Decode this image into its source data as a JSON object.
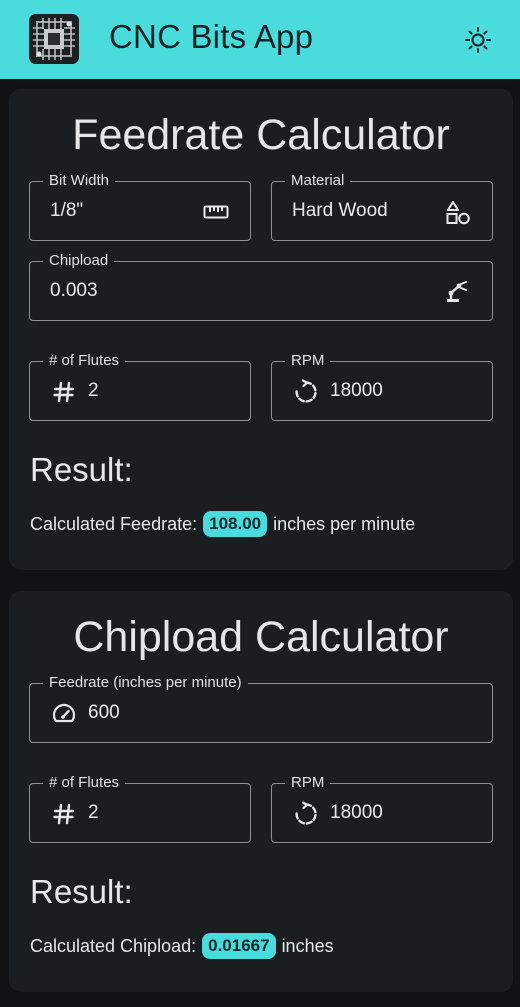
{
  "app": {
    "title": "CNC Bits App",
    "accent_color": "#4adcdc",
    "logo_icon": "circuit-board-logo",
    "theme_toggle_icon": "sun-icon"
  },
  "feedrate_calculator": {
    "title": "Feedrate Calculator",
    "bit_width": {
      "label": "Bit Width",
      "value": "1/8\"",
      "icon": "ruler-icon"
    },
    "material": {
      "label": "Material",
      "value": "Hard Wood",
      "icon": "shapes-icon"
    },
    "chipload": {
      "label": "Chipload",
      "value": "0.003",
      "icon": "robot-arm-icon"
    },
    "flutes": {
      "label": "# of Flutes",
      "value": "2",
      "icon": "hash-icon"
    },
    "rpm": {
      "label": "RPM",
      "value": "18000",
      "icon": "rotate-icon"
    },
    "result_heading": "Result:",
    "result_prefix": "Calculated Feedrate:",
    "result_value": "108.00",
    "result_suffix": "inches per minute"
  },
  "chipload_calculator": {
    "title": "Chipload Calculator",
    "feedrate": {
      "label": "Feedrate (inches per minute)",
      "value": "600",
      "icon": "speedometer-icon"
    },
    "flutes": {
      "label": "# of Flutes",
      "value": "2",
      "icon": "hash-icon"
    },
    "rpm": {
      "label": "RPM",
      "value": "18000",
      "icon": "rotate-icon"
    },
    "result_heading": "Result:",
    "result_prefix": "Calculated Chipload:",
    "result_value": "0.01667",
    "result_suffix": "inches"
  }
}
